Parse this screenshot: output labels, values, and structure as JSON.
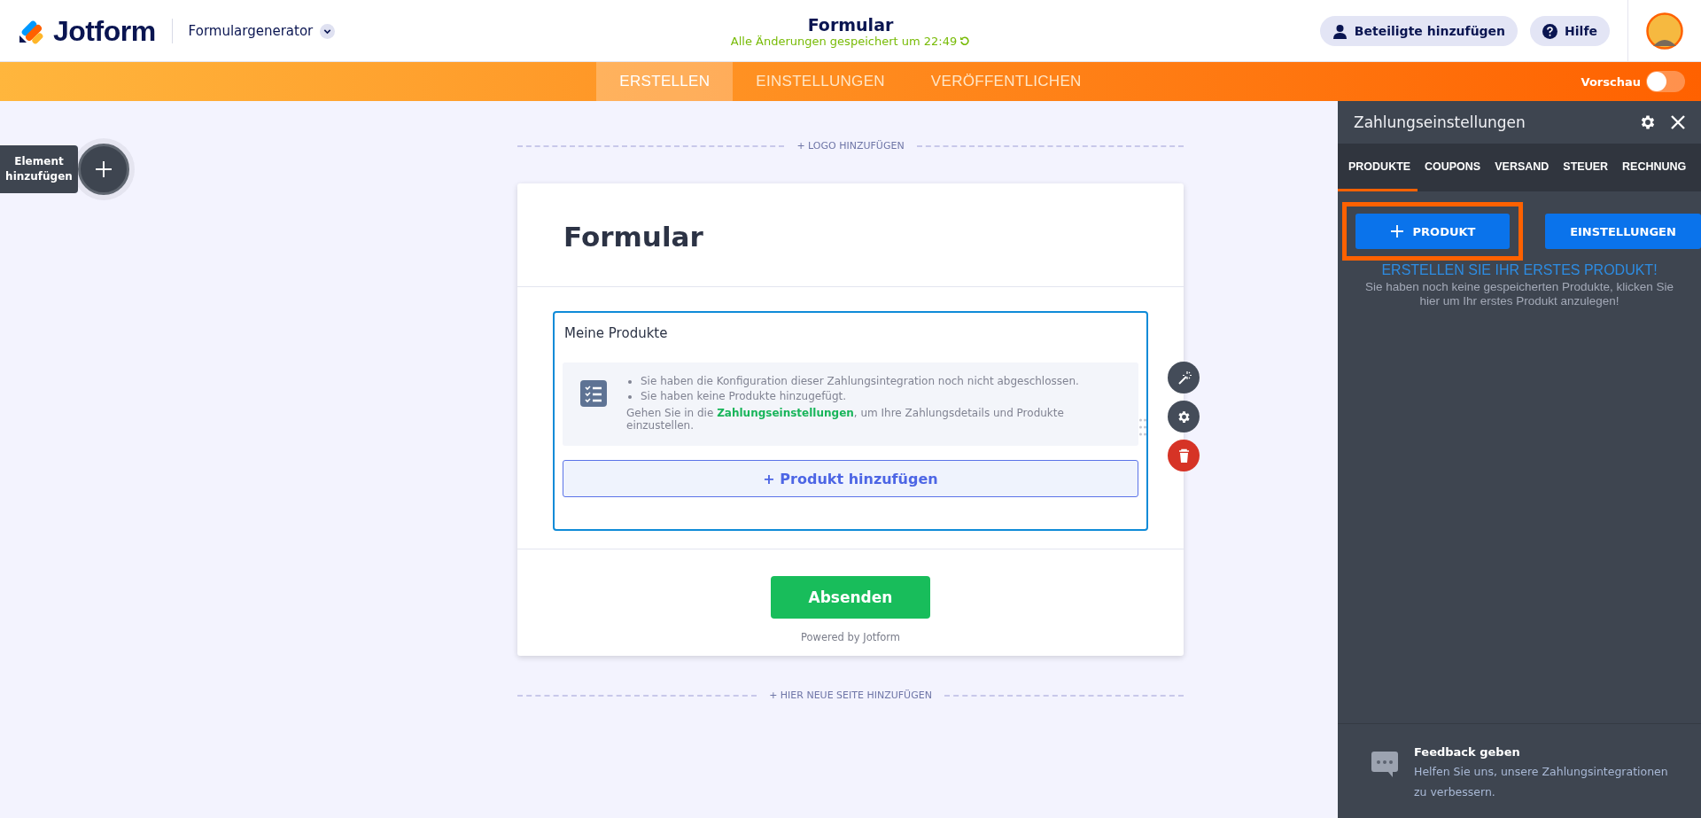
{
  "header": {
    "logo": "Jotform",
    "builder_menu": "Formulargenerator",
    "title": "Formular",
    "save_status": "Alle Änderungen gespeichert um 22:49",
    "buttons": [
      {
        "label": "Beteiligte hinzufügen",
        "kind": "user"
      },
      {
        "label": "Hilfe",
        "kind": "help"
      }
    ]
  },
  "nav": {
    "tabs": [
      {
        "label": "ERSTELLEN",
        "selected": true
      },
      {
        "label": "EINSTELLUNGEN",
        "selected": false
      },
      {
        "label": "VERÖFFENTLICHEN",
        "selected": false
      }
    ],
    "preview": {
      "label": "Vorschau",
      "on": false
    }
  },
  "canvas": {
    "add_element": "Element hinzufügen",
    "logo_link": "+ LOGO HINZUFÜGEN",
    "new_page_link": "+ HIER NEUE SEITE HINZUFÜGEN",
    "form": {
      "title": "Formular",
      "field": {
        "label": "Meine Produkte",
        "notices": [
          "Sie haben die Konfiguration dieser Zahlungsintegration noch nicht abgeschlossen.",
          "Sie haben keine Produkte hinzugefügt."
        ],
        "instruction_before": "Gehen Sie in die",
        "instruction_link": "Zahlungseinstellungen",
        "instruction_after": ", um Ihre Zahlungsdetails und Produkte einzustellen.",
        "add_button": "+ Produkt hinzufügen"
      },
      "submit": "Absenden",
      "powered_by": "Powered by Jotform"
    }
  },
  "panel": {
    "title": "Zahlungseinstellungen",
    "tabs": [
      {
        "label": "PRODUKTE",
        "selected": true
      },
      {
        "label": "COUPONS",
        "selected": false
      },
      {
        "label": "VERSAND",
        "selected": false
      },
      {
        "label": "STEUER",
        "selected": false
      },
      {
        "label": "RECHNUNG",
        "selected": false
      }
    ],
    "buttons": [
      {
        "label": "PRODUKT",
        "kind": "add",
        "highlighted": true
      },
      {
        "label": "EINSTELLUNGEN",
        "kind": "plain",
        "highlighted": false
      }
    ],
    "heading": "ERSTELLEN SIE IHR ERSTES PRODUKT!",
    "text": "Sie haben noch keine gespeicherten Produkte, klicken Sie hier um Ihr erstes Produkt anzulegen!",
    "feedback": {
      "title": "Feedback geben",
      "text": "Helfen Sie uns, unsere Zahlungsintegrationen zu verbessern."
    }
  }
}
